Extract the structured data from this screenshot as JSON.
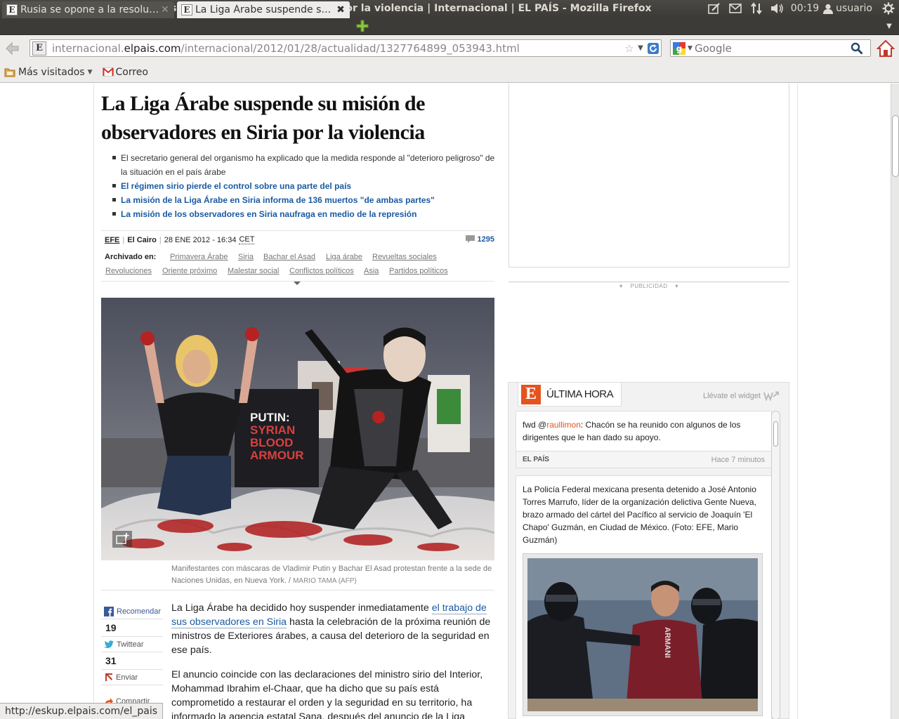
{
  "window": {
    "title": "La Liga Árabe suspende su misión de observadores en Siria por la violencia | Internacional | EL PAÍS - Mozilla Firefox"
  },
  "panel": {
    "clock": "00:19",
    "user": "usuario",
    "icons": [
      "edit-icon",
      "mail-icon",
      "network-icon",
      "volume-icon",
      "user-icon",
      "power-icon"
    ]
  },
  "tabs": [
    {
      "label": "Rusia se opone a la resolución",
      "display": "Rusia se opone a la resoluci…",
      "active": false
    },
    {
      "label": "La Liga Árabe suspende su misión",
      "display": "La Liga Árabe suspende su …",
      "active": true
    }
  ],
  "nav": {
    "url_prefix": "internacional.",
    "url_domain": "elpais.com",
    "url_path": "/internacional/2012/01/28/actualidad/1327764899_053943.html",
    "search_placeholder": "Google"
  },
  "bookmarks": {
    "most_visited": "Más visitados",
    "mail": "Correo"
  },
  "article": {
    "title": "La Liga Árabe suspende su misión de observadores en Siria por la violencia",
    "summary_plain": "El secretario general del organismo ha explicado que la medida responde al \"deterioro peligroso\" de la situación en el país árabe",
    "related": [
      "El régimen sirio pierde el control sobre una parte del país",
      "La misión de la Liga Árabe en Siria informa de 136 muertos \"de ambas partes\"",
      "La misión de los observadores en Siria naufraga en medio de la represión"
    ],
    "agency": "EFE",
    "city": "El Cairo",
    "date": "28 ENE 2012 - 16:34",
    "timezone": "CET",
    "comments": "1295",
    "tags_label": "Archivado en:",
    "tags_row1": [
      "Primavera Árabe",
      "Siria",
      "Bachar el Asad",
      "Liga árabe",
      "Revueltas sociales"
    ],
    "tags_row2": [
      "Revoluciones",
      "Oriente próximo",
      "Malestar social",
      "Conflictos políticos",
      "Asia",
      "Partidos políticos"
    ],
    "photo_sign": [
      "PUTIN:",
      "SYRIAN",
      "BLOOD",
      "ARMOUR"
    ],
    "caption": "Manifestantes con máscaras de Vladimir Putin y Bachar El Asad protestan frente a la sede de Naciones Unidas, en Nueva York. /",
    "caption_credit": "MARIO TAMA (AFP)",
    "share": {
      "recommend": "Recomendar",
      "recommend_count": "19",
      "tweet": "Twittear",
      "tweet_count": "31",
      "send": "Enviar",
      "share": "Compartir"
    },
    "body_p1_before": "La Liga Árabe ha decidido hoy suspender inmediatamente ",
    "body_p1_link": "el trabajo de sus observadores en Siria",
    "body_p1_after": " hasta la celebración de la próxima reunión de ministros de Exteriores árabes, a causa del deterioro de la seguridad en ese país.",
    "body_p2": "El anuncio coincide con las declaraciones del ministro sirio del Interior, Mohammad Ibrahim el-Chaar, que ha dicho que su país está comprometido a restaurar el orden y la seguridad en su territorio, ha informado la agencia estatal Sana, después del anuncio de la Liga"
  },
  "sidebar": {
    "ad_label": "PUBLICIDAD",
    "ultima_hora": {
      "logo": "E",
      "title": "ÚLTIMA HORA",
      "widget_link": "Llévate el widget",
      "item1": {
        "prefix": "fwd @",
        "mention": "raullimon",
        "text": ": Chacón se ha reunido con algunos de los dirigentes que le han dado su apoyo.",
        "source": "EL PAÍS",
        "time": "Hace 7 minutos"
      },
      "item2": {
        "text": "La Policía Federal mexicana presenta detenido a José Antonio Torres Marrufo, líder de la organización delictiva Gente Nueva, brazo armado del cártel del Pacífico al servicio de Joaquín 'El Chapo' Guzmán, en Ciudad de México. (Foto: EFE, Mario Guzmán)",
        "shirt_text": "ARMANI"
      }
    }
  },
  "status": {
    "text": "http://eskup.elpais.com/el_pais"
  },
  "colors": {
    "link": "#1a5aa3",
    "accent": "#e4541e",
    "panel": "#3c3b37"
  }
}
